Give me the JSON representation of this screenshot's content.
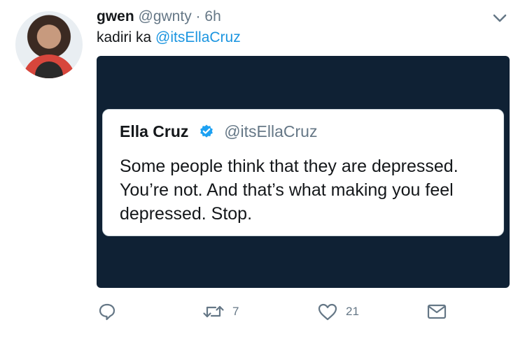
{
  "author": {
    "name": "gwen",
    "handle": "@gwnty",
    "separator": "·",
    "time": "6h"
  },
  "tweet": {
    "text": "kadiri ka",
    "mention": "@itsEllaCruz"
  },
  "quoted_tweet": {
    "name": "Ella Cruz",
    "handle": "@itsEllaCruz",
    "text": "Some people think that they are depressed. You’re not. And that’s what making you feel depressed. Stop."
  },
  "actions": {
    "retweet_count": "7",
    "like_count": "21"
  },
  "colors": {
    "link": "#1b95e0",
    "muted": "#657786",
    "media_bg": "#0f2134",
    "verified": "#1da1f2"
  },
  "icons": [
    "reply-icon",
    "retweet-icon",
    "like-icon",
    "share-icon",
    "chevron-down-icon",
    "verified-badge-icon"
  ]
}
